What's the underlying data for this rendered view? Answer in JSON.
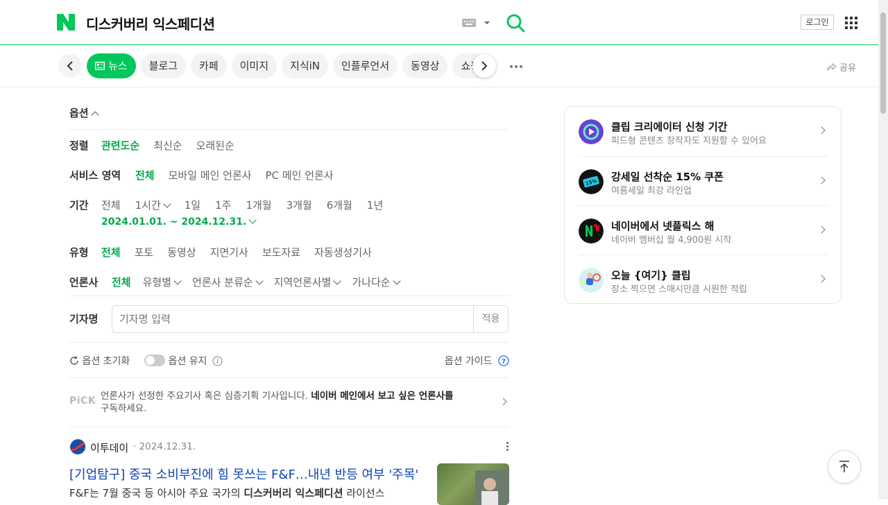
{
  "header": {
    "query": "디스커버리 익스페디션",
    "login_label": "로그인"
  },
  "tabs": {
    "items": [
      "뉴스",
      "블로그",
      "카페",
      "이미지",
      "지식iN",
      "인플루언서",
      "동영상",
      "쇼핑"
    ],
    "active": "뉴스",
    "share_label": "공유"
  },
  "options": {
    "header": "옵션",
    "sort": {
      "label": "정렬",
      "values": [
        "관련도순",
        "최신순",
        "오래된순"
      ]
    },
    "service": {
      "label": "서비스 영역",
      "values": [
        "전체",
        "모바일 메인 언론사",
        "PC 메인 언론사"
      ]
    },
    "period": {
      "label": "기간",
      "values": [
        "전체",
        "1시간",
        "1일",
        "1주",
        "1개월",
        "3개월",
        "6개월",
        "1년"
      ],
      "range": "2024.01.01. ~ 2024.12.31."
    },
    "type": {
      "label": "유형",
      "values": [
        "전체",
        "포토",
        "동영상",
        "지면기사",
        "보도자료",
        "자동생성기사"
      ]
    },
    "press": {
      "label": "언론사",
      "values": [
        "전체",
        "유형별",
        "언론사 분류순",
        "지역언론사별",
        "가나다순"
      ]
    },
    "reporter": {
      "label": "기자명",
      "placeholder": "기자명 입력",
      "apply": "적용"
    },
    "reset": "옵션 초기화",
    "keep": "옵션 유지",
    "guide": "옵션 가이드"
  },
  "pick": {
    "logo": "PiCK",
    "text_before": "언론사가 선정한 주요기사 혹은 심층기획 기사입니다. ",
    "text_bold": "네이버 메인에서 보고 싶은 언론사를",
    "text_after": "구독하세요."
  },
  "article": {
    "press": "이투데이",
    "date": "· 2024.12.31.",
    "title": "[기업탐구] 중국 소비부진에 힘 못쓰는 F&F…내년 반등 여부 '주목'",
    "desc_before": "F&F는 7월 중국 등 아시아 주요 국가의 ",
    "desc_bold": "디스커버리 익스페디션",
    "desc_after": " 라이선스"
  },
  "side": {
    "items": [
      {
        "title": "클립 크리에이터 신청 기간",
        "sub": "피드형 콘텐츠 창작자도 지원할 수 있어요",
        "icon": "clip-icon",
        "color": "#6b3fd4"
      },
      {
        "title": "강세일 선착순 15% 쿠폰",
        "sub": "여름세일 최강 라인업",
        "icon": "coupon-icon",
        "color": "#111111",
        "badge": "15%"
      },
      {
        "title": "네이버에서 넷플릭스 해",
        "sub": "네이버 멤버십 월 4,900원 시작",
        "icon": "netflix-icon",
        "color": "#111111"
      },
      {
        "title": "오늘 {여기} 클립",
        "sub": "장소 찍으면 스매시만큼 시원한 적립",
        "icon": "tennis-icon",
        "color": "#d6f1f6"
      }
    ]
  },
  "colors": {
    "brand": "#03c75a",
    "link": "#0c43b7",
    "active": "#03a94d"
  }
}
